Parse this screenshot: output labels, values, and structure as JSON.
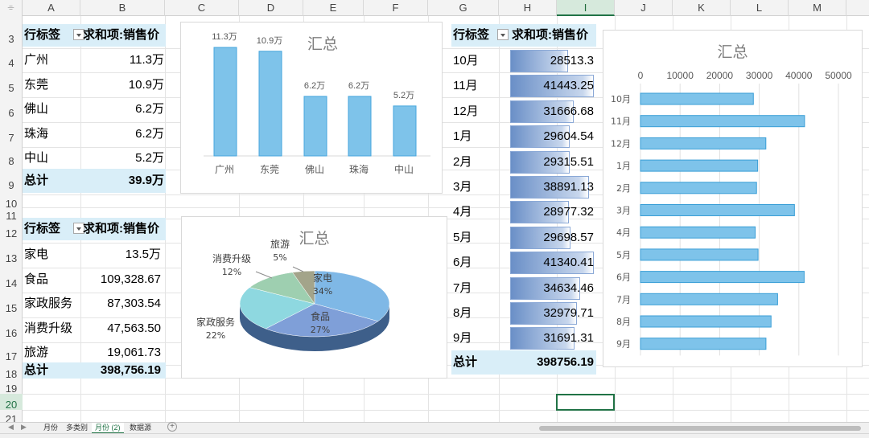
{
  "columns": [
    "A",
    "B",
    "C",
    "D",
    "E",
    "F",
    "G",
    "H",
    "I",
    "J",
    "K",
    "L",
    "M"
  ],
  "rows": [
    "3",
    "4",
    "5",
    "6",
    "7",
    "8",
    "9",
    "10",
    "11",
    "12",
    "13",
    "14",
    "15",
    "16",
    "17",
    "18",
    "19",
    "20",
    "21"
  ],
  "pivot_city": {
    "hdr_label": "行标签",
    "hdr_value": "求和项:销售价",
    "rows": [
      {
        "label": "广州",
        "value": "11.3万"
      },
      {
        "label": "东莞",
        "value": "10.9万"
      },
      {
        "label": "佛山",
        "value": "6.2万"
      },
      {
        "label": "珠海",
        "value": "6.2万"
      },
      {
        "label": "中山",
        "value": "5.2万"
      }
    ],
    "total_label": "总计",
    "total_value": "39.9万"
  },
  "pivot_category": {
    "hdr_label": "行标签",
    "hdr_value": "求和项:销售价",
    "rows": [
      {
        "label": "家电",
        "value": "13.5万"
      },
      {
        "label": "食品",
        "value": "109,328.67"
      },
      {
        "label": "家政服务",
        "value": "87,303.54"
      },
      {
        "label": "消费升级",
        "value": "47,563.50"
      },
      {
        "label": "旅游",
        "value": "19,061.73"
      }
    ],
    "total_label": "总计",
    "total_value": "398,756.19"
  },
  "pivot_month": {
    "hdr_label": "行标签",
    "hdr_value": "求和项:销售价",
    "rows": [
      {
        "label": "10月",
        "value": "28513.3",
        "num": 28513.3
      },
      {
        "label": "11月",
        "value": "41443.25",
        "num": 41443.25
      },
      {
        "label": "12月",
        "value": "31666.68",
        "num": 31666.68
      },
      {
        "label": "1月",
        "value": "29604.54",
        "num": 29604.54
      },
      {
        "label": "2月",
        "value": "29315.51",
        "num": 29315.51
      },
      {
        "label": "3月",
        "value": "38891.13",
        "num": 38891.13
      },
      {
        "label": "4月",
        "value": "28977.32",
        "num": 28977.32
      },
      {
        "label": "5月",
        "value": "29698.57",
        "num": 29698.57
      },
      {
        "label": "6月",
        "value": "41340.41",
        "num": 41340.41
      },
      {
        "label": "7月",
        "value": "34634.46",
        "num": 34634.46
      },
      {
        "label": "8月",
        "value": "32979.71",
        "num": 32979.71
      },
      {
        "label": "9月",
        "value": "31691.31",
        "num": 31691.31
      }
    ],
    "total_label": "总计",
    "total_value": "398756.19"
  },
  "chart_data": [
    {
      "type": "bar",
      "title": "汇总",
      "categories": [
        "广州",
        "东莞",
        "佛山",
        "珠海",
        "中山"
      ],
      "values": [
        113000,
        109000,
        62000,
        62000,
        52000
      ],
      "data_labels": [
        "11.3万",
        "10.9万",
        "6.2万",
        "6.2万",
        "5.2万"
      ],
      "color": "#7ec3ea"
    },
    {
      "type": "pie",
      "title": "汇总",
      "categories": [
        "家电",
        "食品",
        "家政服务",
        "消费升级",
        "旅游"
      ],
      "values": [
        135000,
        109328.67,
        87303.54,
        47563.5,
        19061.73
      ],
      "percent_labels": [
        "34%",
        "27%",
        "22%",
        "12%",
        "5%"
      ],
      "colors": [
        "#7fb8e6",
        "#7f9fd8",
        "#8ed8e0",
        "#9ecfb0",
        "#a3a48a"
      ]
    },
    {
      "type": "bar",
      "orientation": "horizontal",
      "title": "汇总",
      "categories": [
        "10月",
        "11月",
        "12月",
        "1月",
        "2月",
        "3月",
        "4月",
        "5月",
        "6月",
        "7月",
        "8月",
        "9月"
      ],
      "values": [
        28513.3,
        41443.25,
        31666.68,
        29604.54,
        29315.51,
        38891.13,
        28977.32,
        29698.57,
        41340.41,
        34634.46,
        32979.71,
        31691.31
      ],
      "xlim": [
        0,
        50000
      ],
      "x_ticks": [
        "0",
        "10000",
        "20000",
        "30000",
        "40000",
        "50000"
      ],
      "color": "#7ec3ea"
    }
  ],
  "sheet_tabs": [
    "月份",
    "多类别",
    "月份 (2)",
    "数据源"
  ],
  "active_tab": "月份 (2)",
  "colors": {
    "pivot_header": "#d9eef8",
    "accent": "#217346"
  }
}
